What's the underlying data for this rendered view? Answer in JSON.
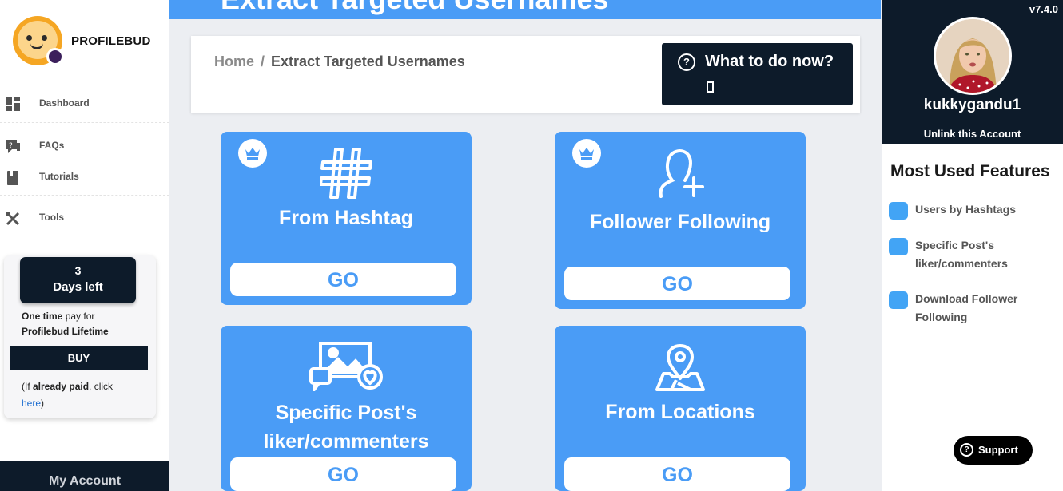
{
  "brand": {
    "name": "PROFILEBUD"
  },
  "sidebar": {
    "items": [
      {
        "label": "Dashboard",
        "icon": "dashboard-icon"
      },
      {
        "label": "FAQs",
        "icon": "faq-icon"
      },
      {
        "label": "Tutorials",
        "icon": "book-icon"
      },
      {
        "label": "Tools",
        "icon": "tools-icon"
      }
    ],
    "promo": {
      "days_num": "3",
      "days_text": "Days left",
      "line1_bold": "One time",
      "line1_rest": " pay for",
      "line2": "Profilebud Lifetime",
      "buy_label": "BUY",
      "note_open": "(If ",
      "note_bold": "already paid",
      "note_rest": ", click",
      "here_label": "here",
      "note_close": ")"
    },
    "my_account": "My Account"
  },
  "main": {
    "banner_title": "Extract Targeted Usernames",
    "breadcrumb": {
      "home": "Home",
      "separator": "/",
      "current": "Extract Targeted Usernames"
    },
    "what_to_do": {
      "label": "What to do now?",
      "q": "?"
    },
    "cards": [
      {
        "title": "From Hashtag",
        "go": "GO",
        "premium": true,
        "icon": "hashtag-icon"
      },
      {
        "title": "Follower Following",
        "go": "GO",
        "premium": true,
        "icon": "user-plus-icon"
      },
      {
        "title_line1": "Specific Post's",
        "title_line2": "liker/commenters",
        "go": "GO",
        "premium": false,
        "icon": "image-comment-like-icon"
      },
      {
        "title": "From Locations",
        "go": "GO",
        "premium": false,
        "icon": "map-pin-icon"
      }
    ]
  },
  "profile": {
    "version": "v7.4.0",
    "username": "kukkygandu1",
    "unlink_label": "Unlink this Account"
  },
  "features": {
    "title": "Most Used Features",
    "items": [
      {
        "line1": "Users by Hashtags"
      },
      {
        "line1": "Specific Post's",
        "line2": "liker/commenters"
      },
      {
        "line1": "Download Follower",
        "line2": "Following"
      }
    ]
  },
  "support": {
    "label": "Support",
    "q": "?"
  },
  "colors": {
    "primary_blue": "#4a9cf6",
    "navy": "#0d1b2a",
    "feature_dot": "#42a4f5"
  }
}
